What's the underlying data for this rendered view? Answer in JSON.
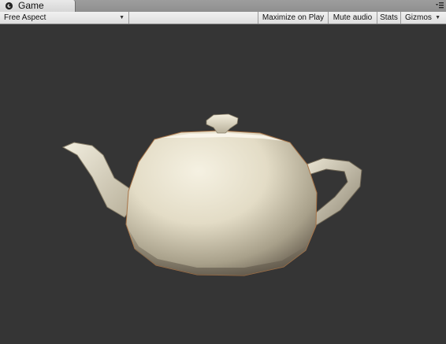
{
  "window": {
    "tab_title": "Game",
    "tab_icon": "game-controller-icon",
    "tab_menu_icon": "window-menu-icon"
  },
  "toolbar": {
    "aspect_dropdown": "Free Aspect",
    "maximize_on_play": "Maximize on Play",
    "mute_audio": "Mute audio",
    "stats": "Stats",
    "gizmos": "Gizmos"
  },
  "viewport": {
    "background_color": "#353535",
    "object": "teapot"
  }
}
